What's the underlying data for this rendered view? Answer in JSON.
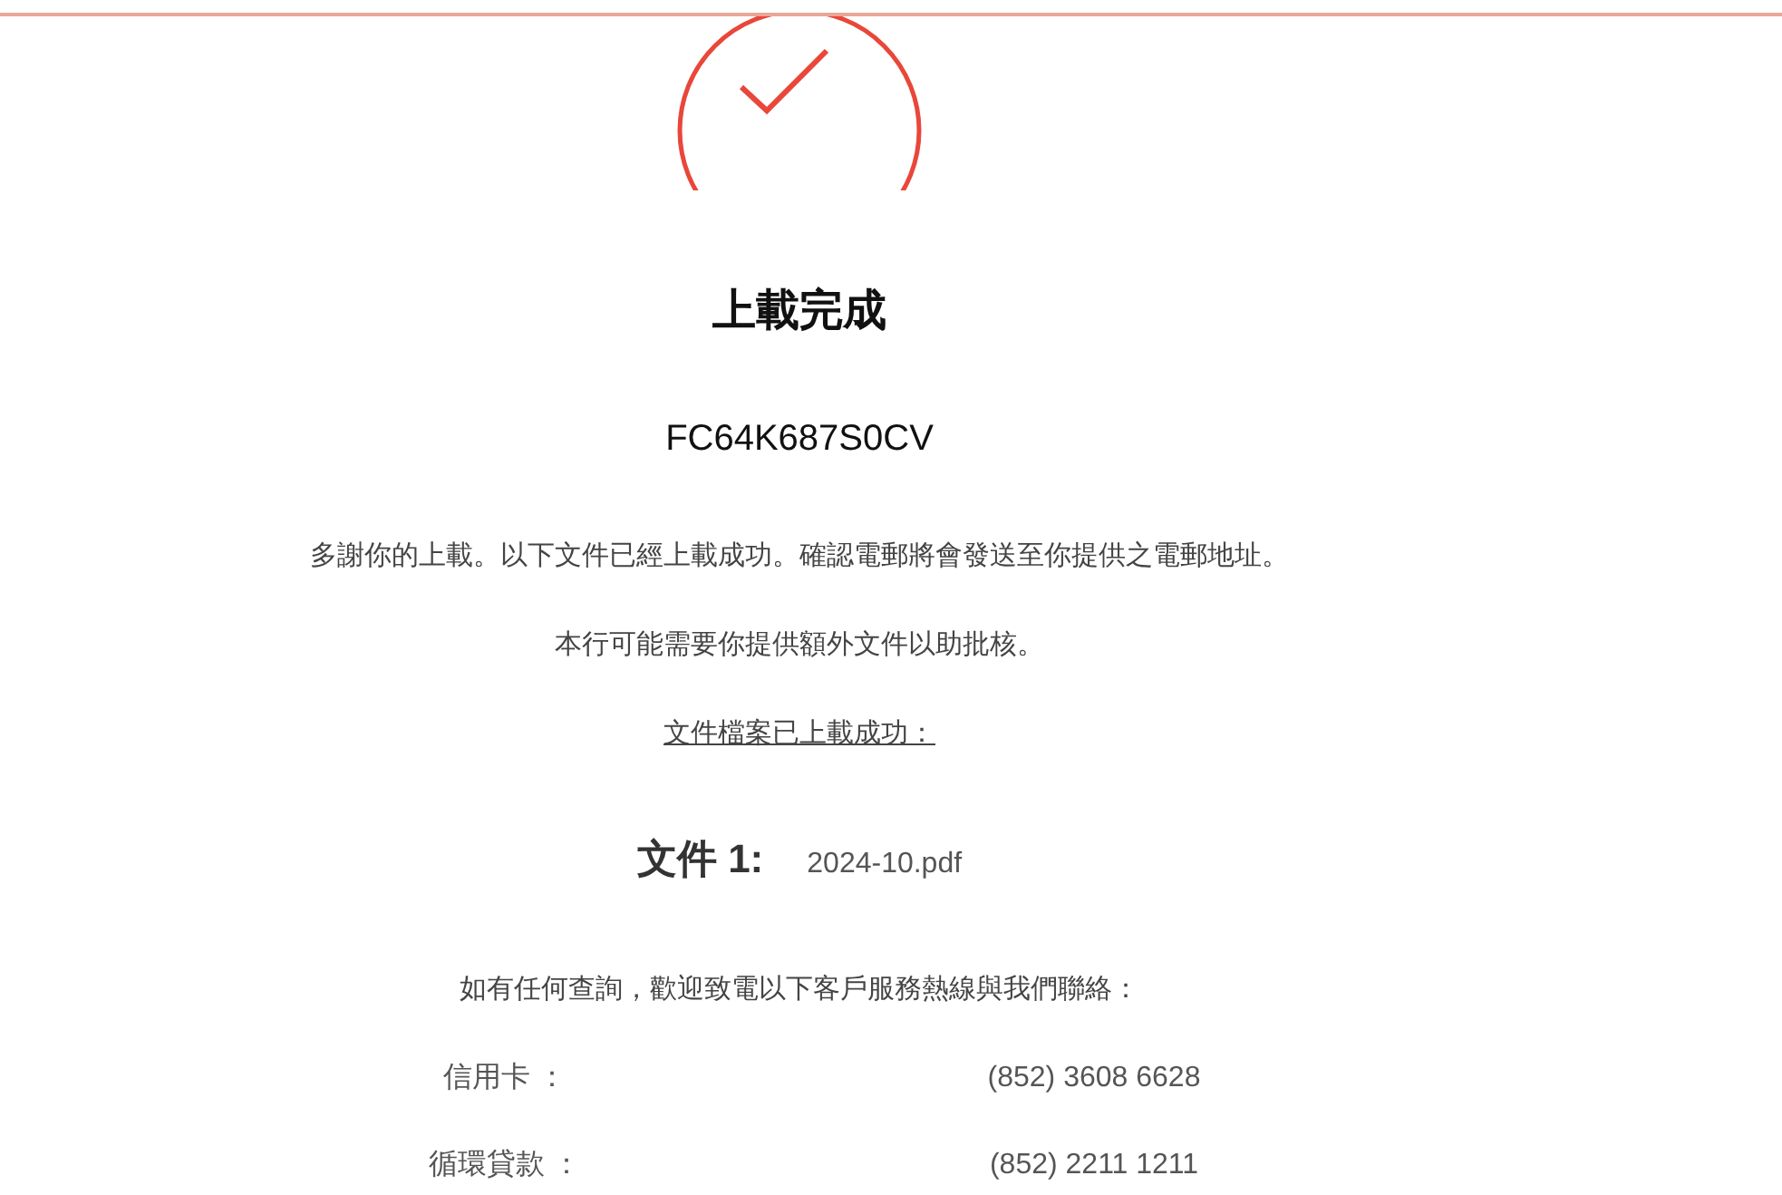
{
  "title": "上載完成",
  "reference": "FC64K687S0CV",
  "messages": [
    "多謝你的上載。以下文件已經上載成功。確認電郵將會發送至你提供之電郵地址。",
    "本行可能需要你提供額外文件以助批核。"
  ],
  "uploaded_heading": "文件檔案已上載成功：",
  "files": [
    {
      "label": "文件 1:",
      "name": "2024-10.pdf"
    }
  ],
  "contact_intro": "如有任何查詢，歡迎致電以下客戶服務熱線與我們聯絡：",
  "hotlines": [
    {
      "label": "信用卡 ：",
      "phone": "(852) 3608 6628"
    },
    {
      "label": "循環貸款 ：",
      "phone": "(852) 2211 1211"
    }
  ]
}
